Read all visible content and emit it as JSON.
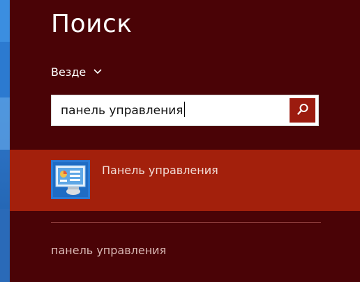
{
  "header": {
    "title": "Поиск"
  },
  "scope": {
    "label": "Везде",
    "icon": "chevron-down-icon"
  },
  "search": {
    "value": "панель управления",
    "button_icon": "search-icon"
  },
  "results": [
    {
      "label": "Панель управления",
      "icon": "control-panel-icon",
      "selected": true
    }
  ],
  "suggestions": [
    {
      "label": "панель управления"
    }
  ],
  "colors": {
    "background": "#4a0306",
    "selected_row": "#a3200c",
    "search_button": "#9c1b0f",
    "text": "#ffffff"
  }
}
